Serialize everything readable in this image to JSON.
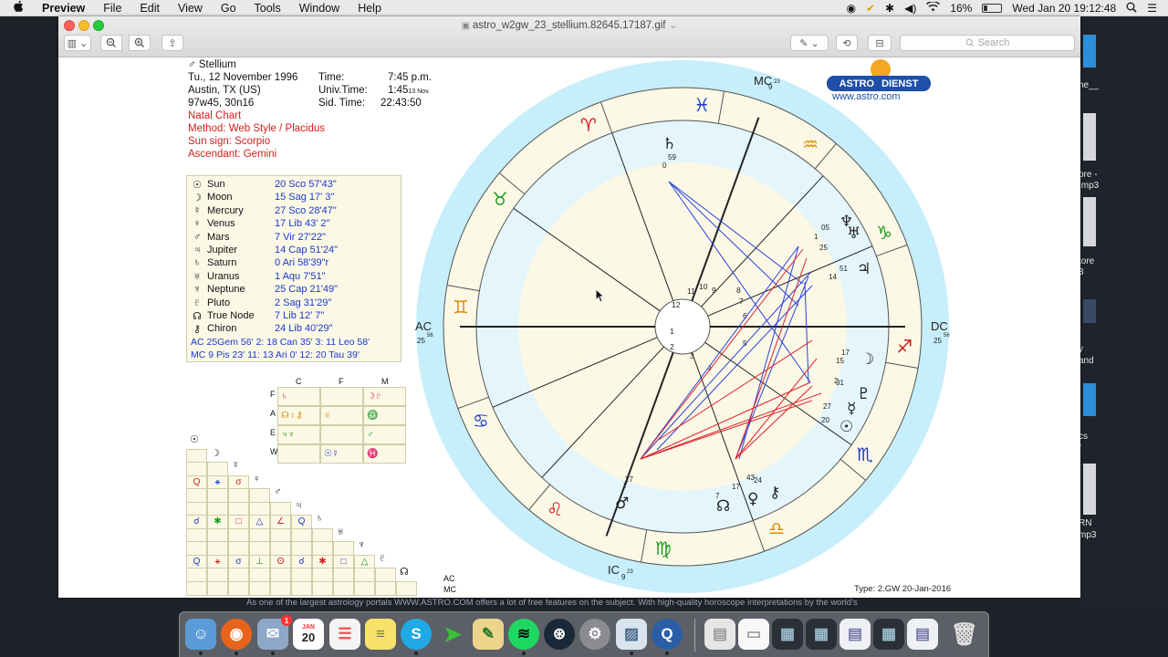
{
  "menubar": {
    "apple": "",
    "app": "Preview",
    "items": [
      "File",
      "Edit",
      "View",
      "Go",
      "Tools",
      "Window",
      "Help"
    ],
    "battery": "16%",
    "battery_level": 0.16,
    "clock": "Wed Jan 20  19:12:48"
  },
  "window": {
    "title": "astro_w2gw_23_stellium.82645.17187.gif",
    "search_placeholder": "Search"
  },
  "chart_header": {
    "name": "Stellium",
    "date": "Tu., 12 November 1996",
    "place": "Austin, TX (US)",
    "coords": "97w45, 30n16",
    "time_label": "Time:",
    "time_value": "7:45 p.m.",
    "ut_label": "Univ.Time:",
    "ut_value": "1:45",
    "ut_note": "13 Nov.",
    "sid_label": "Sid. Time:",
    "sid_value": "22:43:50",
    "natal": "Natal Chart",
    "method": "Method: Web Style / Placidus",
    "sun_sign": "Sun sign: Scorpio",
    "ascendant": "Ascendant: Gemini"
  },
  "planets": [
    {
      "glyph": "☉",
      "name": "Sun",
      "pos": "20 Sco 57'43\""
    },
    {
      "glyph": "☽",
      "name": "Moon",
      "pos": "15 Sag 17'  3\""
    },
    {
      "glyph": "☿",
      "name": "Mercury",
      "pos": "27 Sco 28'47\""
    },
    {
      "glyph": "♀",
      "name": "Venus",
      "pos": "17  Lib  43'  2\""
    },
    {
      "glyph": "♂",
      "name": "Mars",
      "pos": "7  Vir  27'22\""
    },
    {
      "glyph": "♃",
      "name": "Jupiter",
      "pos": "14 Cap 51'24\""
    },
    {
      "glyph": "♄",
      "name": "Saturn",
      "pos": "0  Ari  58'39\"r"
    },
    {
      "glyph": "♅",
      "name": "Uranus",
      "pos": "1 Aqu  7'51\""
    },
    {
      "glyph": "♆",
      "name": "Neptune",
      "pos": "25 Cap 21'49\""
    },
    {
      "glyph": "♇",
      "name": "Pluto",
      "pos": "2 Sag 31'29\""
    },
    {
      "glyph": "☊",
      "name": "True Node",
      "pos": "7  Lib  12'  7\""
    },
    {
      "glyph": "⚷",
      "name": "Chiron",
      "pos": "24  Lib  40'29\""
    }
  ],
  "cusps": [
    "AC 25Gem 56'   2: 18 Can 35'   3: 11 Leo  58'",
    "MC  9  Pis  23'  11: 13  Ari   0'  12: 20 Tau  39'"
  ],
  "elements": {
    "cols": [
      "C",
      "F",
      "M"
    ],
    "rows": [
      "F",
      "A",
      "E",
      "W"
    ],
    "cells": [
      [
        "♄",
        "",
        "☽♇"
      ],
      [
        "☊♀⚷",
        "♅",
        "♎"
      ],
      [
        "♃♆",
        "",
        "♂"
      ],
      [
        "",
        "☉☿",
        "♓"
      ]
    ]
  },
  "aspect_header_glyphs": [
    "☉",
    "☽",
    "☿",
    "♀",
    "♂",
    "♃",
    "♄",
    "♅",
    "♆",
    "♇",
    "☊"
  ],
  "aspect_side_labels": [
    "AC",
    "MC"
  ],
  "wheel": {
    "mc_label": "MC",
    "mc_deg": "9",
    "mc_min": "23",
    "ic_label": "IC",
    "ic_deg": "9",
    "ic_min": "23",
    "ac_label": "AC",
    "ac_deg": "25",
    "ac_min": "56",
    "dc_label": "DC",
    "dc_deg": "25",
    "dc_min": "56",
    "house_numbers": [
      "1",
      "2",
      "3",
      "4",
      "5",
      "6",
      "7",
      "8",
      "9",
      "10",
      "11",
      "12"
    ],
    "signs": [
      "♈",
      "♉",
      "♊",
      "♋",
      "♌",
      "♍",
      "♎",
      "♏",
      "♐",
      "♑",
      "♒",
      "♓"
    ],
    "planet_degrees": {
      "saturn": "0",
      "saturn_min": "59",
      "uranus": "1",
      "neptune": "25",
      "neptune_min": "05",
      "jupiter": "14",
      "jupiter_min": "51",
      "moon": "15",
      "moon_min": "17",
      "mercury": "27",
      "sun": "20",
      "pluto": "2",
      "pluto_min": "31",
      "chiron": "24",
      "venus": "17",
      "node": "7",
      "mars": "7",
      "mars_min": "27",
      "chiron_min": "43"
    }
  },
  "logo": {
    "left": "ASTRO",
    "right": "DIENST",
    "url": "www.astro.com"
  },
  "footer": "Type: 2.GW   20-Jan-2016",
  "below_text": "As one of the largest astrology portals WWW.ASTRO.COM offers a lot of free features on the subject. With high-quality horoscope interpretations by the world's",
  "desktop_labels": [
    "he__",
    "ore -",
    ".mp3",
    "tore",
    "3",
    "y",
    "and",
    "cs",
    "r",
    "RN",
    "mp3"
  ],
  "dock": {
    "calendar_month": "JAN",
    "calendar_day": "20",
    "mail_badge": "1"
  }
}
